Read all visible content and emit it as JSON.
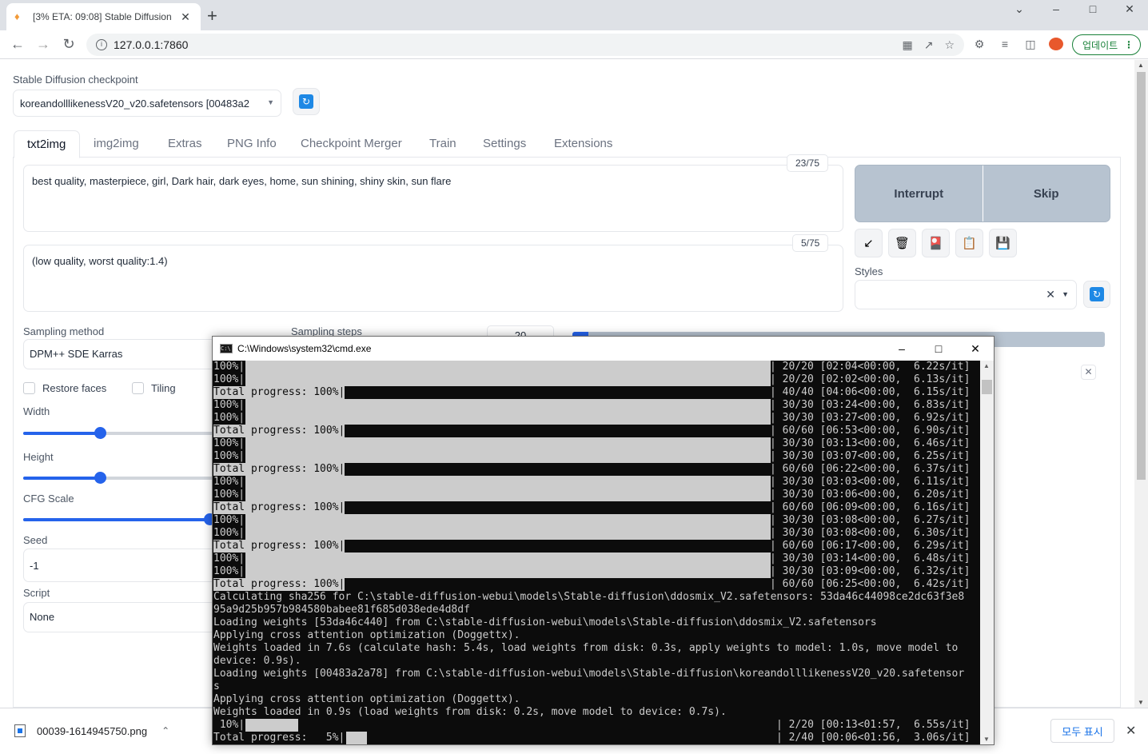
{
  "browser": {
    "tab_title": "[3% ETA: 09:08] Stable Diffusion",
    "url": "127.0.0.1:7860",
    "update_label": "업데이트"
  },
  "app": {
    "checkpoint_label": "Stable Diffusion checkpoint",
    "checkpoint_value": "koreandolllikenessV20_v20.safetensors [00483a2",
    "tabs": [
      "txt2img",
      "img2img",
      "Extras",
      "PNG Info",
      "Checkpoint Merger",
      "Train",
      "Settings",
      "Extensions"
    ],
    "prompt": "best quality, masterpiece, girl, Dark hair, dark eyes, home, sun shining, shiny skin, sun flare",
    "prompt_counter": "23/75",
    "negative_prompt": "(low quality, worst quality:1.4)",
    "negative_counter": "5/75",
    "interrupt_label": "Interrupt",
    "skip_label": "Skip",
    "styles_label": "Styles",
    "sampling_method_label": "Sampling method",
    "sampling_method_value": "DPM++ SDE Karras",
    "sampling_steps_label": "Sampling steps",
    "sampling_steps_value": "20",
    "restore_faces_label": "Restore faces",
    "tiling_label": "Tiling",
    "width_label": "Width",
    "height_label": "Height",
    "cfg_label": "CFG Scale",
    "seed_label": "Seed",
    "seed_value": "-1",
    "script_label": "Script",
    "script_value": "None",
    "progress_fraction": 0.03
  },
  "downloads": {
    "filename": "00039-1614945750.png",
    "show_all": "모두 표시"
  },
  "cmd": {
    "title": "C:\\Windows\\system32\\cmd.exe",
    "progress_lines": [
      {
        "left": "100%|",
        "right": "| 20/20 [02:04<00:00,  6.22s/it]",
        "total": false
      },
      {
        "left": "100%|",
        "right": "| 20/20 [02:02<00:00,  6.13s/it]",
        "total": false
      },
      {
        "left": "Total progress: 100%|",
        "right": "| 40/40 [04:06<00:00,  6.15s/it]",
        "total": true
      },
      {
        "left": "100%|",
        "right": "| 30/30 [03:24<00:00,  6.83s/it]",
        "total": false
      },
      {
        "left": "100%|",
        "right": "| 30/30 [03:27<00:00,  6.92s/it]",
        "total": false
      },
      {
        "left": "Total progress: 100%|",
        "right": "| 60/60 [06:53<00:00,  6.90s/it]",
        "total": true
      },
      {
        "left": "100%|",
        "right": "| 30/30 [03:13<00:00,  6.46s/it]",
        "total": false
      },
      {
        "left": "100%|",
        "right": "| 30/30 [03:07<00:00,  6.25s/it]",
        "total": false
      },
      {
        "left": "Total progress: 100%|",
        "right": "| 60/60 [06:22<00:00,  6.37s/it]",
        "total": true
      },
      {
        "left": "100%|",
        "right": "| 30/30 [03:03<00:00,  6.11s/it]",
        "total": false
      },
      {
        "left": "100%|",
        "right": "| 30/30 [03:06<00:00,  6.20s/it]",
        "total": false
      },
      {
        "left": "Total progress: 100%|",
        "right": "| 60/60 [06:09<00:00,  6.16s/it]",
        "total": true
      },
      {
        "left": "100%|",
        "right": "| 30/30 [03:08<00:00,  6.27s/it]",
        "total": false
      },
      {
        "left": "100%|",
        "right": "| 30/30 [03:08<00:00,  6.30s/it]",
        "total": false
      },
      {
        "left": "Total progress: 100%|",
        "right": "| 60/60 [06:17<00:00,  6.29s/it]",
        "total": true
      },
      {
        "left": "100%|",
        "right": "| 30/30 [03:14<00:00,  6.48s/it]",
        "total": false
      },
      {
        "left": "100%|",
        "right": "| 30/30 [03:09<00:00,  6.32s/it]",
        "total": false
      },
      {
        "left": "Total progress: 100%|",
        "right": "| 60/60 [06:25<00:00,  6.42s/it]",
        "total": true
      }
    ],
    "log_lines": [
      "Calculating sha256 for C:\\stable-diffusion-webui\\models\\Stable-diffusion\\ddosmix_V2.safetensors: 53da46c44098ce2dc63f3e8",
      "95a9d25b957b984580babee81f685d038ede4d8df",
      "Loading weights [53da46c440] from C:\\stable-diffusion-webui\\models\\Stable-diffusion\\ddosmix_V2.safetensors",
      "Applying cross attention optimization (Doggettx).",
      "Weights loaded in 7.6s (calculate hash: 5.4s, load weights from disk: 0.3s, apply weights to model: 1.0s, move model to",
      "device: 0.9s).",
      "Loading weights [00483a2a78] from C:\\stable-diffusion-webui\\models\\Stable-diffusion\\koreandolllikenessV20_v20.safetensor",
      "s",
      "Applying cross attention optimization (Doggettx).",
      "Weights loaded in 0.9s (load weights from disk: 0.2s, move model to device: 0.7s)."
    ],
    "current_lines": [
      {
        "left": " 10%|",
        "right": "| 2/20 [00:13<01:57,  6.55s/it]",
        "fraction": 0.1
      },
      {
        "left": "Total progress:   5%|",
        "right": "| 2/40 [00:06<01:56,  3.06s/it]",
        "fraction": 0.05
      }
    ]
  }
}
